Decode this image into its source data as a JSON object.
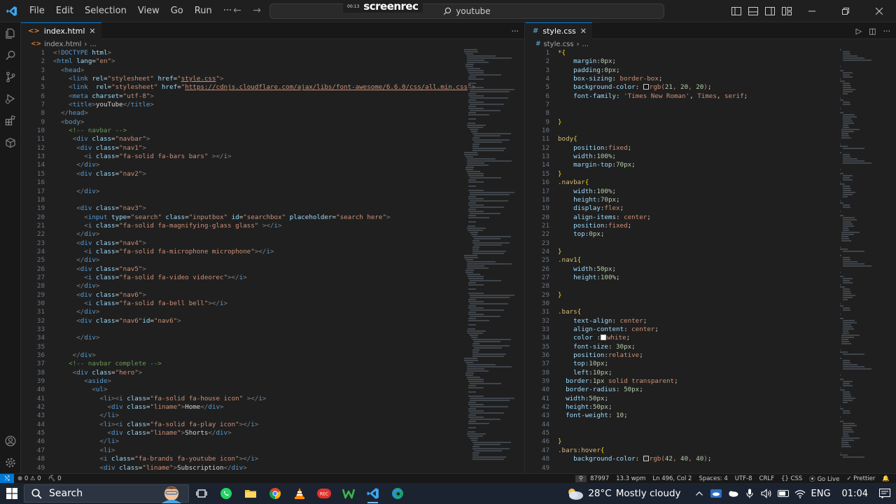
{
  "titlebar": {
    "menu": [
      "File",
      "Edit",
      "Selection",
      "View",
      "Go",
      "Run",
      "···"
    ],
    "search_text": "youtube",
    "recorder": {
      "time": "00:13",
      "brand": "screenrec"
    }
  },
  "left_editor": {
    "tab_label": "index.html",
    "breadcrumb": "index.html",
    "breadcrumb_more": "...",
    "lines": [
      {
        "n": "1",
        "h": "<span class='br'>&lt;!</span><span class='tg'>DOCTYPE</span> <span class='at'>html</span><span class='br'>&gt;</span>"
      },
      {
        "n": "2",
        "h": "<span class='br'>&lt;</span><span class='tg'>html</span> <span class='at'>lang</span>=<span class='st'>\"en\"</span><span class='br'>&gt;</span>"
      },
      {
        "n": "3",
        "h": "  <span class='br'>&lt;</span><span class='tg'>head</span><span class='br'>&gt;</span>"
      },
      {
        "n": "4",
        "h": "    <span class='br'>&lt;</span><span class='tg'>link</span> <span class='at'>rel</span>=<span class='st'>\"stylesheet\"</span> <span class='at'>href</span>=<span class='st'>\"<u>style.css</u>\"</span><span class='br'>&gt;</span>"
      },
      {
        "n": "5",
        "h": "    <span class='br'>&lt;</span><span class='tg'>link</span>  <span class='at'>rel</span>=<span class='st'>\"stylesheet\"</span> <span class='at'>href</span>=<span class='st'>\"<u>https://cdnjs.cloudflare.com/ajax/libs/font-awesome/6.6.0/css/all.min.css</u>\"</span><span class='br'>&gt;</span>"
      },
      {
        "n": "6",
        "h": "    <span class='br'>&lt;</span><span class='tg'>meta</span> <span class='at'>charset</span>=<span class='st'>\"utf-8\"</span><span class='br'>&gt;</span>"
      },
      {
        "n": "7",
        "h": "    <span class='br'>&lt;</span><span class='tg'>title</span><span class='br'>&gt;</span>youTube<span class='br'>&lt;/</span><span class='tg'>title</span><span class='br'>&gt;</span>"
      },
      {
        "n": "8",
        "h": "  <span class='br'>&lt;/</span><span class='tg'>head</span><span class='br'>&gt;</span>"
      },
      {
        "n": "9",
        "h": "  <span class='br'>&lt;</span><span class='tg'>body</span><span class='br'>&gt;</span>"
      },
      {
        "n": "10",
        "h": "    <span class='cm'>&lt;!-- navbar --&gt;</span>"
      },
      {
        "n": "11",
        "h": "     <span class='br'>&lt;</span><span class='tg'>div</span> <span class='at'>class</span>=<span class='st'>\"navbar\"</span><span class='br'>&gt;</span>"
      },
      {
        "n": "12",
        "h": "      <span class='br'>&lt;</span><span class='tg'>div</span> <span class='at'>class</span>=<span class='st'>\"nav1\"</span><span class='br'>&gt;</span>"
      },
      {
        "n": "13",
        "h": "        <span class='br'>&lt;</span><span class='tg'>i</span> <span class='at'>class</span>=<span class='st'>\"fa-solid fa-bars bars\"</span> <span class='br'>&gt;&lt;/</span><span class='tg'>i</span><span class='br'>&gt;</span>"
      },
      {
        "n": "14",
        "h": "      <span class='br'>&lt;/</span><span class='tg'>div</span><span class='br'>&gt;</span>"
      },
      {
        "n": "15",
        "h": "      <span class='br'>&lt;</span><span class='tg'>div</span> <span class='at'>class</span>=<span class='st'>\"nav2\"</span><span class='br'>&gt;</span>"
      },
      {
        "n": "16",
        "h": ""
      },
      {
        "n": "17",
        "h": "      <span class='br'>&lt;/</span><span class='tg'>div</span><span class='br'>&gt;</span>"
      },
      {
        "n": "18",
        "h": ""
      },
      {
        "n": "19",
        "h": "      <span class='br'>&lt;</span><span class='tg'>div</span> <span class='at'>class</span>=<span class='st'>\"nav3\"</span><span class='br'>&gt;</span>"
      },
      {
        "n": "20",
        "h": "        <span class='br'>&lt;</span><span class='tg'>input</span> <span class='at'>type</span>=<span class='st'>\"search\"</span> <span class='at'>class</span>=<span class='st'>\"inputbox\"</span> <span class='at'>id</span>=<span class='st'>\"searchbox\"</span> <span class='at'>placeholder</span>=<span class='st'>\"search here\"</span><span class='br'>&gt;</span>"
      },
      {
        "n": "21",
        "h": "        <span class='br'>&lt;</span><span class='tg'>i</span> <span class='at'>class</span>=<span class='st'>\"fa-solid fa-magnifying-glass glass\"</span> <span class='br'>&gt;&lt;/</span><span class='tg'>i</span><span class='br'>&gt;</span>"
      },
      {
        "n": "22",
        "h": "      <span class='br'>&lt;/</span><span class='tg'>div</span><span class='br'>&gt;</span>"
      },
      {
        "n": "23",
        "h": "      <span class='br'>&lt;</span><span class='tg'>div</span> <span class='at'>class</span>=<span class='st'>\"nav4\"</span><span class='br'>&gt;</span>"
      },
      {
        "n": "24",
        "h": "        <span class='br'>&lt;</span><span class='tg'>i</span> <span class='at'>class</span>=<span class='st'>\"fa-solid fa-microphone microphone\"</span><span class='br'>&gt;&lt;/</span><span class='tg'>i</span><span class='br'>&gt;</span>"
      },
      {
        "n": "25",
        "h": "      <span class='br'>&lt;/</span><span class='tg'>div</span><span class='br'>&gt;</span>"
      },
      {
        "n": "26",
        "h": "      <span class='br'>&lt;</span><span class='tg'>div</span> <span class='at'>class</span>=<span class='st'>\"nav5\"</span><span class='br'>&gt;</span>"
      },
      {
        "n": "27",
        "h": "        <span class='br'>&lt;</span><span class='tg'>i</span> <span class='at'>class</span>=<span class='st'>\"fa-solid fa-video videorec\"</span><span class='br'>&gt;&lt;/</span><span class='tg'>i</span><span class='br'>&gt;</span>"
      },
      {
        "n": "28",
        "h": "      <span class='br'>&lt;/</span><span class='tg'>div</span><span class='br'>&gt;</span>"
      },
      {
        "n": "29",
        "h": "      <span class='br'>&lt;</span><span class='tg'>div</span> <span class='at'>class</span>=<span class='st'>\"nav6\"</span><span class='br'>&gt;</span>"
      },
      {
        "n": "30",
        "h": "        <span class='br'>&lt;</span><span class='tg'>i</span> <span class='at'>class</span>=<span class='st'>\"fa-solid fa-bell bell\"</span><span class='br'>&gt;&lt;/</span><span class='tg'>i</span><span class='br'>&gt;</span>"
      },
      {
        "n": "31",
        "h": "      <span class='br'>&lt;/</span><span class='tg'>div</span><span class='br'>&gt;</span>"
      },
      {
        "n": "32",
        "h": "      <span class='br'>&lt;</span><span class='tg'>div</span> <span class='at'>class</span>=<span class='st'>\"nav6\"</span><span class='at'>id</span>=<span class='st'>\"nav6\"</span><span class='br'>&gt;</span>"
      },
      {
        "n": "33",
        "h": ""
      },
      {
        "n": "34",
        "h": "      <span class='br'>&lt;/</span><span class='tg'>div</span><span class='br'>&gt;</span>"
      },
      {
        "n": "35",
        "h": ""
      },
      {
        "n": "36",
        "h": "     <span class='br'>&lt;/</span><span class='tg'>div</span><span class='br'>&gt;</span>"
      },
      {
        "n": "37",
        "h": "    <span class='cm'>&lt;!-- navbar complete --&gt;</span>"
      },
      {
        "n": "38",
        "h": "     <span class='br'>&lt;</span><span class='tg'>div</span> <span class='at'>class</span>=<span class='st'>\"hero\"</span><span class='br'>&gt;</span>"
      },
      {
        "n": "39",
        "h": "        <span class='br'>&lt;</span><span class='tg'>aside</span><span class='br'>&gt;</span>"
      },
      {
        "n": "40",
        "h": "          <span class='br'>&lt;</span><span class='tg'>ul</span><span class='br'>&gt;</span>"
      },
      {
        "n": "41",
        "h": "            <span class='br'>&lt;</span><span class='tg'>li</span><span class='br'>&gt;&lt;</span><span class='tg'>i</span> <span class='at'>class</span>=<span class='st'>\"fa-solid fa-house icon\"</span> <span class='br'>&gt;&lt;/</span><span class='tg'>i</span><span class='br'>&gt;</span>"
      },
      {
        "n": "42",
        "h": "              <span class='br'>&lt;</span><span class='tg'>div</span> <span class='at'>class</span>=<span class='st'>\"liname\"</span><span class='br'>&gt;</span>Home<span class='br'>&lt;/</span><span class='tg'>div</span><span class='br'>&gt;</span>"
      },
      {
        "n": "43",
        "h": "            <span class='br'>&lt;/</span><span class='tg'>li</span><span class='br'>&gt;</span>"
      },
      {
        "n": "44",
        "h": "            <span class='br'>&lt;</span><span class='tg'>li</span><span class='br'>&gt;&lt;</span><span class='tg'>i</span> <span class='at'>class</span>=<span class='st'>\"fa-solid fa-play icon\"</span><span class='br'>&gt;&lt;/</span><span class='tg'>i</span><span class='br'>&gt;</span>"
      },
      {
        "n": "45",
        "h": "              <span class='br'>&lt;</span><span class='tg'>div</span> <span class='at'>class</span>=<span class='st'>\"liname\"</span><span class='br'>&gt;</span>Shorts<span class='br'>&lt;/</span><span class='tg'>div</span><span class='br'>&gt;</span>"
      },
      {
        "n": "46",
        "h": "            <span class='br'>&lt;/</span><span class='tg'>li</span><span class='br'>&gt;</span>"
      },
      {
        "n": "47",
        "h": "            <span class='br'>&lt;</span><span class='tg'>li</span><span class='br'>&gt;</span>"
      },
      {
        "n": "48",
        "h": "            <span class='br'>&lt;</span><span class='tg'>i</span> <span class='at'>class</span>=<span class='st'>\"fa-brands fa-youtube icon\"</span><span class='br'>&gt;&lt;/</span><span class='tg'>i</span><span class='br'>&gt;</span>"
      },
      {
        "n": "49",
        "h": "            <span class='br'>&lt;</span><span class='tg'>div</span> <span class='at'>class</span>=<span class='st'>\"liname\"</span><span class='br'>&gt;</span>Subscription<span class='br'>&lt;/</span><span class='tg'>div</span><span class='br'>&gt;</span>"
      }
    ]
  },
  "right_editor": {
    "tab_label": "style.css",
    "breadcrumb": "style.css",
    "breadcrumb_more": "...",
    "lines": [
      {
        "n": "1",
        "h": "<span class='sel'>*</span><span class='brace'>{</span>"
      },
      {
        "n": "2",
        "h": "    <span class='pr'>margin</span>:<span class='nm'>0px</span>;"
      },
      {
        "n": "3",
        "h": "    <span class='pr'>padding</span>:<span class='nm'>0px</span>;"
      },
      {
        "n": "4",
        "h": "    <span class='pr'>box-sizing</span>: <span class='vl'>border-box</span>;"
      },
      {
        "n": "5",
        "h": "    <span class='pr'>background-color</span>: <span class='swatch' style='background:#151414'></span><span class='vl'>rgb(<span class='nm'>21</span>, <span class='nm'>20</span>, <span class='nm'>20</span>)</span>;"
      },
      {
        "n": "6",
        "h": "    <span class='pr'>font-family</span>: <span class='st'>'Times New Roman'</span>, <span class='vl'>Times</span>, <span class='vl'>serif</span>;"
      },
      {
        "n": "7",
        "h": ""
      },
      {
        "n": "8",
        "h": ""
      },
      {
        "n": "9",
        "h": "<span class='brace'>}</span>"
      },
      {
        "n": "10",
        "h": ""
      },
      {
        "n": "11",
        "h": "<span class='sel'>body</span><span class='brace'>{</span>"
      },
      {
        "n": "12",
        "h": "    <span class='pr'>position</span>:<span class='vl'>fixed</span>;"
      },
      {
        "n": "13",
        "h": "    <span class='pr'>width</span>:<span class='nm'>100%</span>;"
      },
      {
        "n": "14",
        "h": "    <span class='pr'>margin-top</span>:<span class='nm'>70px</span>;"
      },
      {
        "n": "15",
        "h": "<span class='brace'>}</span>"
      },
      {
        "n": "16",
        "h": "<span class='sel'>.navbar</span><span class='brace'>{</span>"
      },
      {
        "n": "17",
        "h": "    <span class='pr'>width</span>:<span class='nm'>100%</span>;"
      },
      {
        "n": "18",
        "h": "    <span class='pr'>height</span>:<span class='nm'>70px</span>;"
      },
      {
        "n": "19",
        "h": "    <span class='pr'>display</span>:<span class='vl'>flex</span>;"
      },
      {
        "n": "20",
        "h": "    <span class='pr'>align-items</span>: <span class='vl'>center</span>;"
      },
      {
        "n": "21",
        "h": "    <span class='pr'>position</span>:<span class='vl'>fixed</span>;"
      },
      {
        "n": "22",
        "h": "    <span class='pr'>top</span>:<span class='nm'>0px</span>;"
      },
      {
        "n": "23",
        "h": ""
      },
      {
        "n": "24",
        "h": "<span class='brace'>}</span>"
      },
      {
        "n": "25",
        "h": "<span class='sel'>.nav1</span><span class='brace'>{</span>"
      },
      {
        "n": "26",
        "h": "    <span class='pr'>width</span>:<span class='nm'>50px</span>;"
      },
      {
        "n": "27",
        "h": "    <span class='pr'>height</span>:<span class='nm'>100%</span>;"
      },
      {
        "n": "28",
        "h": ""
      },
      {
        "n": "29",
        "h": "<span class='brace'>}</span>"
      },
      {
        "n": "30",
        "h": ""
      },
      {
        "n": "31",
        "h": "<span class='sel'>.bars</span><span class='brace'>{</span>"
      },
      {
        "n": "32",
        "h": "    <span class='pr'>text-align</span>: <span class='vl'>center</span>;"
      },
      {
        "n": "33",
        "h": "    <span class='pr'>align-content</span>: <span class='vl'>center</span>;"
      },
      {
        "n": "34",
        "h": "    <span class='pr'>color</span> :<span class='swatch' style='background:#ffffff'></span><span class='vl'>white</span>;"
      },
      {
        "n": "35",
        "h": "    <span class='pr'>font-size</span>: <span class='nm'>30px</span>;"
      },
      {
        "n": "36",
        "h": "    <span class='pr'>position</span>:<span class='vl'>relative</span>;"
      },
      {
        "n": "37",
        "h": "    <span class='pr'>top</span>:<span class='nm'>10px</span>;"
      },
      {
        "n": "38",
        "h": "    <span class='pr'>left</span>:<span class='nm'>10px</span>;"
      },
      {
        "n": "39",
        "h": "  <span class='pr'>border</span>:<span class='nm'>1px</span> <span class='vl'>solid</span> <span class='vl'>transparent</span>;"
      },
      {
        "n": "40",
        "h": "  <span class='pr'>border-radius</span>: <span class='nm'>50px</span>;"
      },
      {
        "n": "41",
        "h": "  <span class='pr'>width</span>:<span class='nm'>50px</span>;"
      },
      {
        "n": "42",
        "h": "  <span class='pr'>height</span>:<span class='nm'>50px</span>;"
      },
      {
        "n": "43",
        "h": "  <span class='pr'>font-weight</span>: <span class='nm'>10</span>;"
      },
      {
        "n": "44",
        "h": ""
      },
      {
        "n": "45",
        "h": ""
      },
      {
        "n": "46",
        "h": "<span class='brace'>}</span>"
      },
      {
        "n": "47",
        "h": "<span class='sel'>.bars:hover</span><span class='brace'>{</span>"
      },
      {
        "n": "48",
        "h": "    <span class='pr'>background-color</span>: <span class='swatch' style='background:#2a2828'></span><span class='vl'>rgb(<span class='nm'>42</span>, <span class='nm'>40</span>, <span class='nm'>40</span>)</span>;"
      },
      {
        "n": "49",
        "h": ""
      }
    ]
  },
  "statusbar": {
    "problems": "⊗ 0 ⚠ 0",
    "ports": "⛏ 0",
    "zoom_icon": "zoom-icon",
    "count": "87997",
    "wpm": "13.3 wpm",
    "position": "Ln 496, Col 2",
    "spaces": "Spaces: 4",
    "encoding": "UTF-8",
    "eol": "CRLF",
    "language": "{} CSS",
    "golive": "Go Live",
    "prettier": "✓ Prettier",
    "bell": "🔔"
  },
  "taskbar": {
    "search_label": "Search",
    "weather_temp": "28°C",
    "weather_desc": "Mostly cloudy",
    "language": "ENG",
    "time": "01:04"
  },
  "colors": {
    "accent": "#0078d4",
    "editor_bg": "#1f1f1f",
    "taskbar_bg": "#1c2330"
  }
}
